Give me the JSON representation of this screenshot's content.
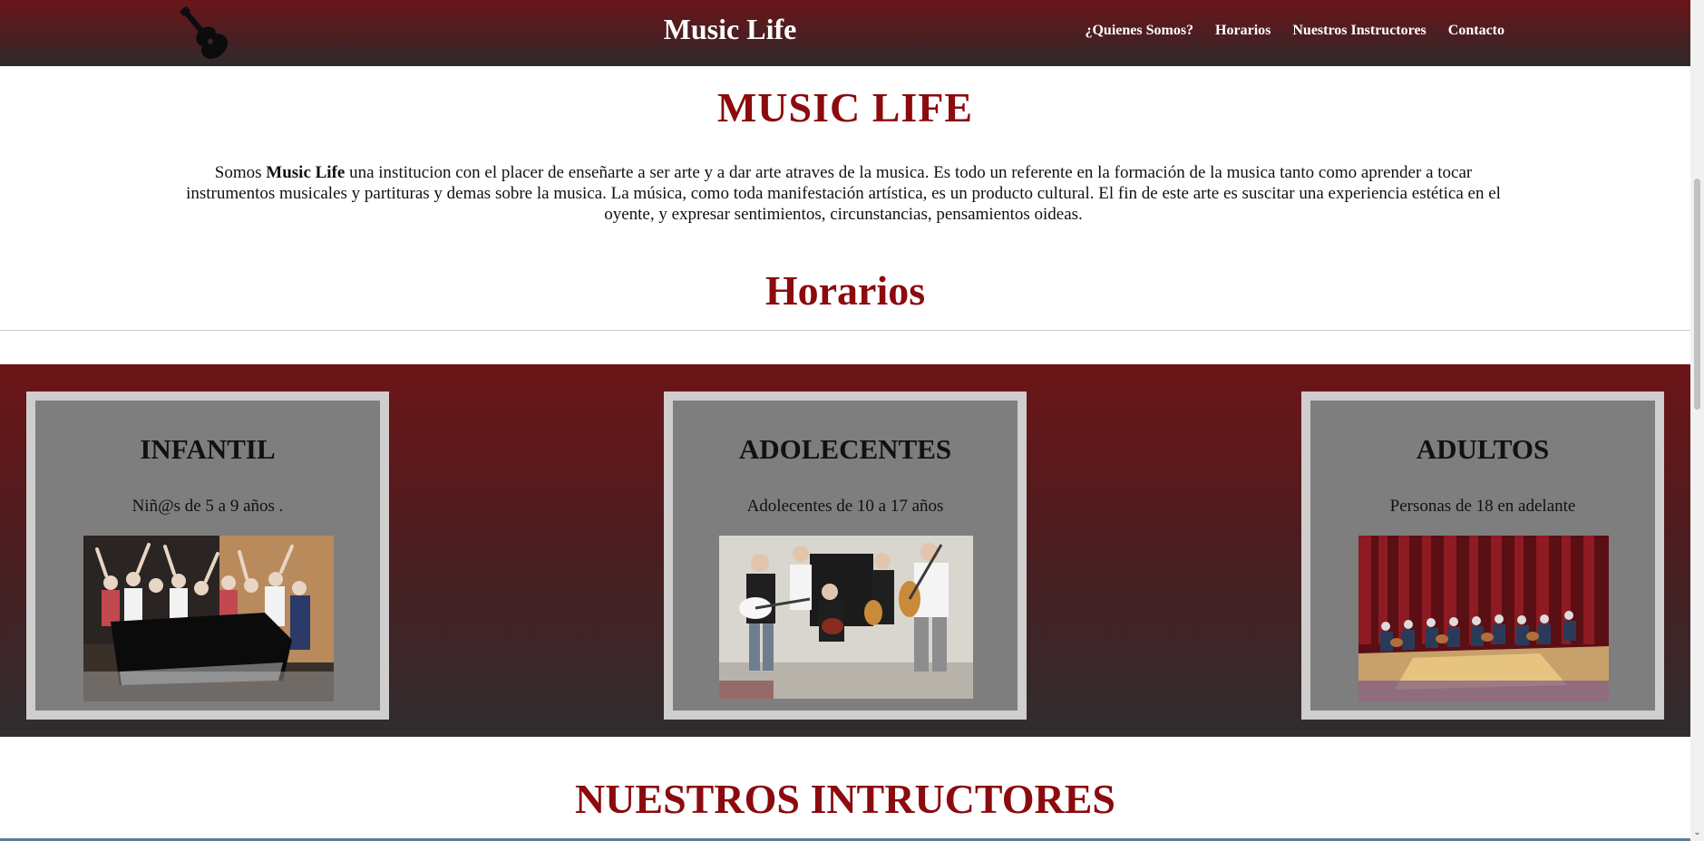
{
  "header": {
    "brand": "Music Life",
    "logo_icon": "guitar-icon",
    "nav": [
      {
        "label": "¿Quienes Somos?"
      },
      {
        "label": "Horarios"
      },
      {
        "label": "Nuestros Instructores"
      },
      {
        "label": "Contacto"
      }
    ]
  },
  "about": {
    "title": "MUSIC LIFE",
    "text_before": "Somos ",
    "text_bold": "Music Life",
    "text_after": " una institucion con el placer de enseñarte a ser arte y a dar arte atraves de la musica. Es todo un referente en la formación de la musica tanto como aprender a tocar instrumentos musicales y partituras y demas sobre la musica. La música, como toda manifestación artística, es un producto cultural. El fin de este arte es suscitar una experiencia estética en el oyente, y expresar sentimientos, circunstancias, pensamientos oideas."
  },
  "schedule": {
    "title": "Horarios",
    "cards": [
      {
        "title": "INFANTIL",
        "subtitle": "Niñ@s de 5 a 9 años ."
      },
      {
        "title": "ADOLECENTES",
        "subtitle": "Adolecentes de 10 a 17 años"
      },
      {
        "title": "ADULTOS",
        "subtitle": "Personas de 18 en adelante"
      }
    ]
  },
  "instructors": {
    "title": "NUESTROS INTRUCTORES"
  },
  "colors": {
    "accent": "#8b0b0e",
    "header_top": "#6b1519",
    "header_bottom": "#2f2b2c",
    "card_border": "#d0cdcd",
    "card_bg": "#7e7e7e"
  }
}
